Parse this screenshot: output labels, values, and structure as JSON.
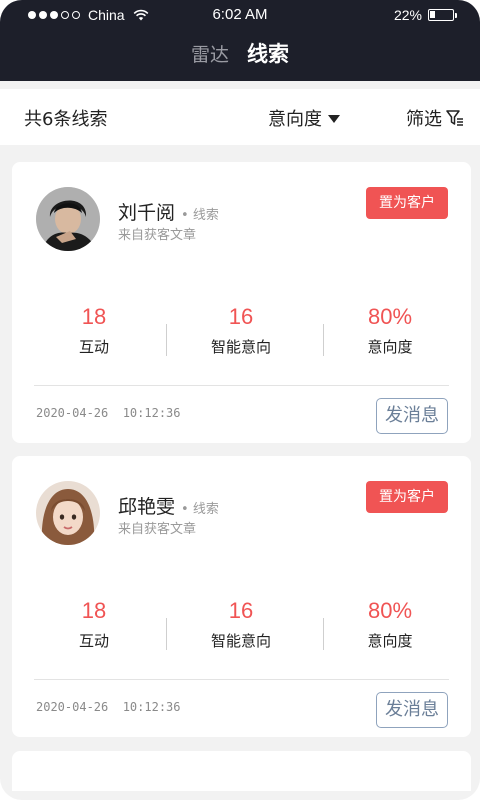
{
  "status_bar": {
    "carrier": "China",
    "time": "6:02 AM",
    "battery_text": "22%",
    "battery_level": 0.22,
    "signal_bars_filled": 3,
    "signal_bars_total": 5
  },
  "nav": {
    "tabs": [
      {
        "label": "雷达",
        "active": false
      },
      {
        "label": "线索",
        "active": true
      }
    ]
  },
  "filter_bar": {
    "count_label": "共6条线索",
    "sort_label": "意向度",
    "filter_label": "筛选"
  },
  "leads": [
    {
      "name": "刘千阅",
      "tag": "线索",
      "source": "来自获客文章",
      "set_customer_label": "置为客户",
      "stats": [
        {
          "value": "18",
          "label": "互动"
        },
        {
          "value": "16",
          "label": "智能意向"
        },
        {
          "value": "80%",
          "label": "意向度"
        }
      ],
      "datetime": "2020-04-26  10:12:36",
      "message_label": "发消息"
    },
    {
      "name": "邱艳雯",
      "tag": "线索",
      "source": "来自获客文章",
      "set_customer_label": "置为客户",
      "stats": [
        {
          "value": "18",
          "label": "互动"
        },
        {
          "value": "16",
          "label": "智能意向"
        },
        {
          "value": "80%",
          "label": "意向度"
        }
      ],
      "datetime": "2020-04-26  10:12:36",
      "message_label": "发消息"
    }
  ],
  "colors": {
    "header_bg": "#1d1f2a",
    "accent_red": "#f05454",
    "message_border": "#8fa3bd"
  }
}
